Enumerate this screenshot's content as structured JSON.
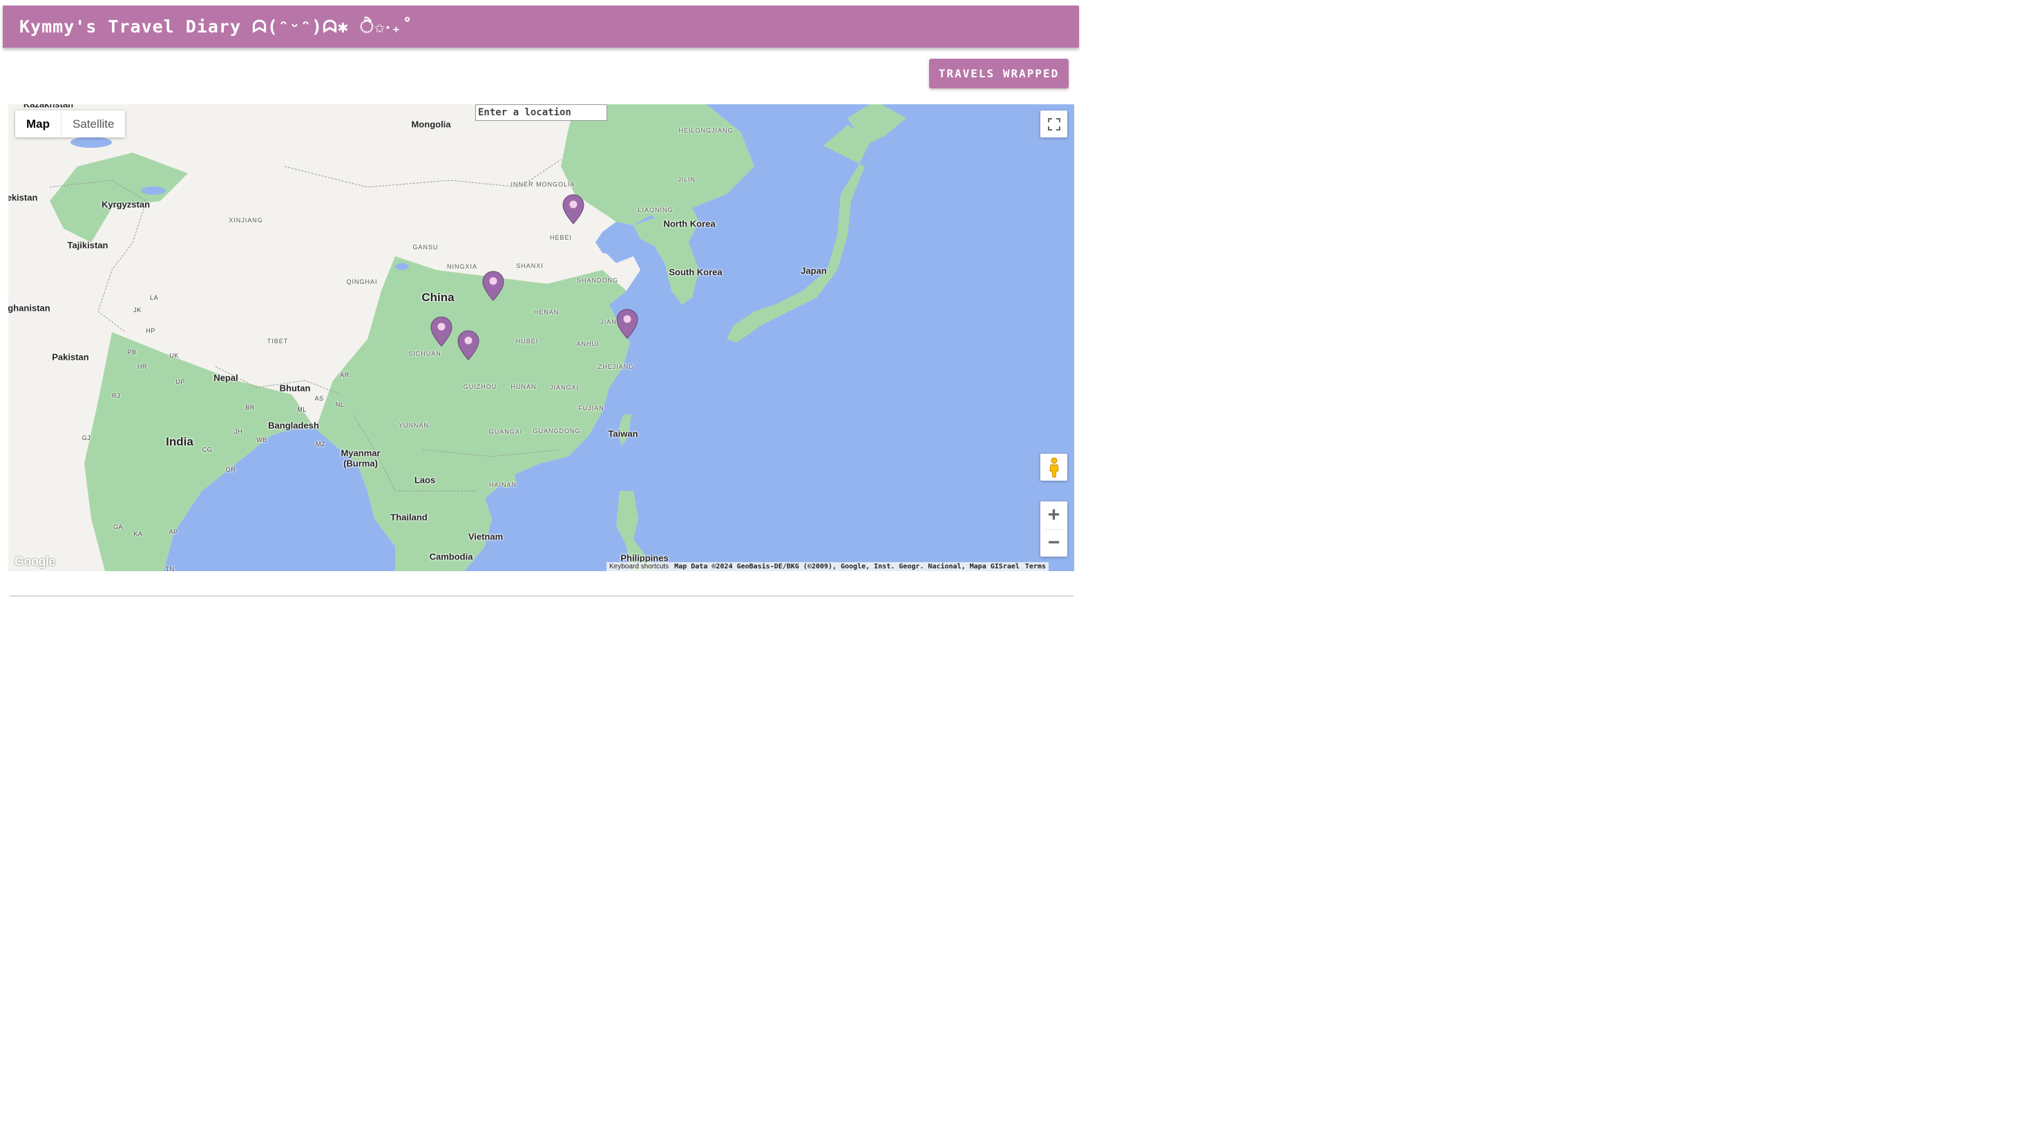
{
  "header": {
    "title": "Kymmy's Travel Diary ᗣ(ᵔᵕᵔ)ᗣ✱ ੈ✩‧₊˚"
  },
  "actions": {
    "wrapped_label": "TRAVELS WRAPPED"
  },
  "map": {
    "search_placeholder": "Enter a location",
    "map_type_options": [
      "Map",
      "Satellite"
    ],
    "map_type_selected": "Map",
    "google_logo": "Google",
    "attribution": {
      "keyboard": "Keyboard shortcuts",
      "data": "Map Data ©2024 GeoBasis-DE/BKG (©2009), Google, Inst. Geogr. Nacional, Mapa GISrael",
      "terms": "Terms"
    },
    "zoom_in": "+",
    "zoom_out": "−",
    "pin_color": "#9a6aa8",
    "water_color": "#94b4f0",
    "land_color": "#f4f2ee",
    "green_color": "#a7d7a8",
    "labels": [
      {
        "text": "Kazakhstan",
        "kind": "country"
      },
      {
        "text": "Mongolia",
        "kind": "country"
      },
      {
        "text": "Kyrgyzstan",
        "kind": "country"
      },
      {
        "text": "ekistan",
        "kind": "country"
      },
      {
        "text": "Tajikistan",
        "kind": "country"
      },
      {
        "text": "XINJIANG",
        "kind": "prov"
      },
      {
        "text": "INNER MONGOLIA",
        "kind": "prov"
      },
      {
        "text": "HEILONGJIANG",
        "kind": "prov"
      },
      {
        "text": "JILIN",
        "kind": "prov"
      },
      {
        "text": "LIAONING",
        "kind": "prov"
      },
      {
        "text": "North Korea",
        "kind": "country"
      },
      {
        "text": "South Korea",
        "kind": "country"
      },
      {
        "text": "Japan",
        "kind": "country"
      },
      {
        "text": "HEBEI",
        "kind": "prov"
      },
      {
        "text": "GANSU",
        "kind": "prov"
      },
      {
        "text": "NINGXIA",
        "kind": "prov"
      },
      {
        "text": "SHANXI",
        "kind": "prov"
      },
      {
        "text": "SHANDONG",
        "kind": "prov"
      },
      {
        "text": "QINGHAI",
        "kind": "prov"
      },
      {
        "text": "China",
        "kind": "big"
      },
      {
        "text": "ghanistan",
        "kind": "country"
      },
      {
        "text": "HENAN",
        "kind": "prov"
      },
      {
        "text": "JIAN",
        "kind": "prov"
      },
      {
        "text": "TIBET",
        "kind": "prov"
      },
      {
        "text": "HUBEI",
        "kind": "prov"
      },
      {
        "text": "ANHUI",
        "kind": "prov"
      },
      {
        "text": "SICHUAN",
        "kind": "prov"
      },
      {
        "text": "ZHEJIANG",
        "kind": "prov"
      },
      {
        "text": "Pakistan",
        "kind": "country"
      },
      {
        "text": "Nepal",
        "kind": "country"
      },
      {
        "text": "Bhutan",
        "kind": "country"
      },
      {
        "text": "GUIZHOU",
        "kind": "prov"
      },
      {
        "text": "HUNAN",
        "kind": "prov"
      },
      {
        "text": "JIANGXI",
        "kind": "prov"
      },
      {
        "text": "FUJIAN",
        "kind": "prov"
      },
      {
        "text": "Bangladesh",
        "kind": "country"
      },
      {
        "text": "YUNNAN",
        "kind": "prov"
      },
      {
        "text": "GUANGXI",
        "kind": "prov"
      },
      {
        "text": "GUANGDONG",
        "kind": "prov"
      },
      {
        "text": "Taiwan",
        "kind": "country"
      },
      {
        "text": "India",
        "kind": "big"
      },
      {
        "text": "Myanmar",
        "kind": "country"
      },
      {
        "text": "(Burma)",
        "kind": "country"
      },
      {
        "text": "Laos",
        "kind": "country"
      },
      {
        "text": "HAINAN",
        "kind": "prov"
      },
      {
        "text": "Thailand",
        "kind": "country"
      },
      {
        "text": "Vietnam",
        "kind": "country"
      },
      {
        "text": "Cambodia",
        "kind": "country"
      },
      {
        "text": "Philippines",
        "kind": "country"
      },
      {
        "text": "LA",
        "kind": "small"
      },
      {
        "text": "JK",
        "kind": "small"
      },
      {
        "text": "HP",
        "kind": "small"
      },
      {
        "text": "PB",
        "kind": "small"
      },
      {
        "text": "HR",
        "kind": "small"
      },
      {
        "text": "UK",
        "kind": "small"
      },
      {
        "text": "UP",
        "kind": "small"
      },
      {
        "text": "RJ",
        "kind": "small"
      },
      {
        "text": "BR",
        "kind": "small"
      },
      {
        "text": "AR",
        "kind": "small"
      },
      {
        "text": "AS",
        "kind": "small"
      },
      {
        "text": "NL",
        "kind": "small"
      },
      {
        "text": "ML",
        "kind": "small"
      },
      {
        "text": "JH",
        "kind": "small"
      },
      {
        "text": "WB",
        "kind": "small"
      },
      {
        "text": "MZ",
        "kind": "small"
      },
      {
        "text": "GJ",
        "kind": "small"
      },
      {
        "text": "CG",
        "kind": "small"
      },
      {
        "text": "OR",
        "kind": "small"
      },
      {
        "text": "GA",
        "kind": "small"
      },
      {
        "text": "KA",
        "kind": "small"
      },
      {
        "text": "AP",
        "kind": "small"
      },
      {
        "text": "TN",
        "kind": "small"
      }
    ],
    "markers": [
      {
        "name": "marker-beijing"
      },
      {
        "name": "marker-xian"
      },
      {
        "name": "marker-chengdu"
      },
      {
        "name": "marker-chongqing"
      },
      {
        "name": "marker-shanghai"
      }
    ]
  }
}
